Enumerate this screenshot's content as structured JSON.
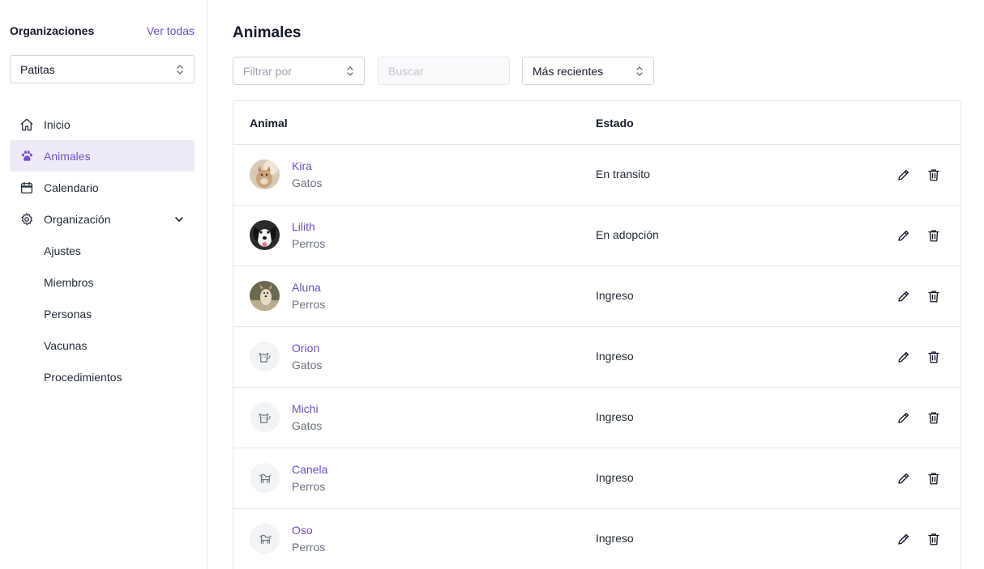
{
  "sidebar": {
    "org_title": "Organizaciones",
    "org_view_all": "Ver todas",
    "org_selected": "Patitas",
    "nav": [
      {
        "label": "Inicio",
        "icon": "home-icon"
      },
      {
        "label": "Animales",
        "icon": "paw-icon",
        "active": true
      },
      {
        "label": "Calendario",
        "icon": "calendar-icon"
      },
      {
        "label": "Organización",
        "icon": "gear-icon"
      }
    ],
    "subnav": [
      "Ajustes",
      "Miembros",
      "Personas",
      "Vacunas",
      "Procedimientos"
    ]
  },
  "main": {
    "title": "Animales",
    "filter_placeholder": "Filtrar por",
    "search_placeholder": "Buscar",
    "sort_selected": "Más recientes",
    "columns": [
      "Animal",
      "Estado"
    ],
    "rows": [
      {
        "name": "Kira",
        "species": "Gatos",
        "status": "En transito",
        "avatar": "photo-cat"
      },
      {
        "name": "Lilith",
        "species": "Perros",
        "status": "En adopción",
        "avatar": "photo-dog-bw"
      },
      {
        "name": "Aluna",
        "species": "Perros",
        "status": "Ingreso",
        "avatar": "photo-dog-tan"
      },
      {
        "name": "Orion",
        "species": "Gatos",
        "status": "Ingreso",
        "avatar": "cat-placeholder-icon"
      },
      {
        "name": "Michi",
        "species": "Gatos",
        "status": "Ingreso",
        "avatar": "cat-placeholder-icon"
      },
      {
        "name": "Canela",
        "species": "Perros",
        "status": "Ingreso",
        "avatar": "dog-placeholder-icon"
      },
      {
        "name": "Oso",
        "species": "Perros",
        "status": "Ingreso",
        "avatar": "dog-placeholder-icon"
      }
    ]
  },
  "colors": {
    "accent": "#6d4fc2",
    "active_bg": "#eeeaf8",
    "border": "#e5e7eb"
  }
}
